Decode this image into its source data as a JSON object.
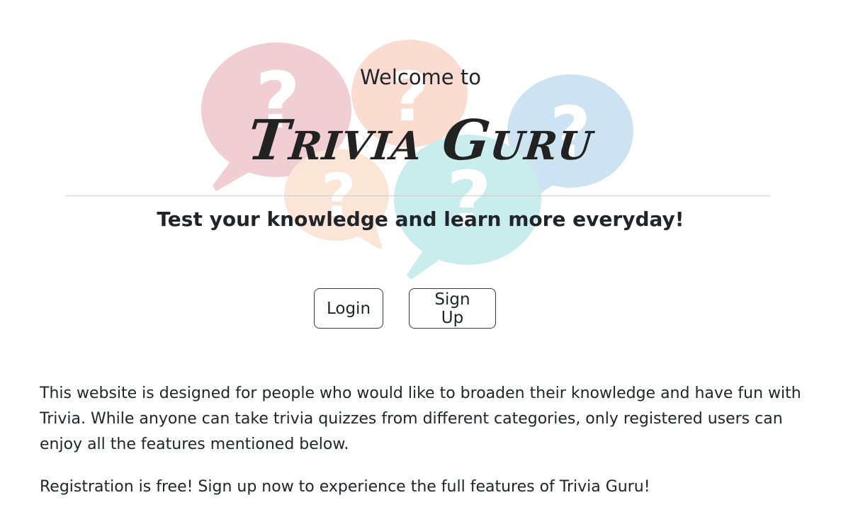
{
  "hero": {
    "welcome": "Welcome to",
    "brand": "Trivia Guru",
    "tagline": "Test your knowledge and learn more everyday!",
    "bubble_icon_glyph": "?",
    "bubble_colors": [
      "#f0ced3",
      "#fbdcd1",
      "#cde3f2",
      "#fbe5d6",
      "#c9ecec"
    ]
  },
  "actions": {
    "login_label": "Login",
    "signup_label": "Sign Up"
  },
  "content": {
    "description": "This website is designed for people who would like to broaden their knowledge and have fun with Trivia. While anyone can take trivia quizzes from different categories, only registered users can enjoy all the features mentioned below.",
    "registration_note": "Registration is free! Sign up now to experience the full features of Trivia Guru!"
  },
  "colors": {
    "text": "#212529",
    "button_border": "#343a40",
    "divider": "#cfcfcf"
  }
}
